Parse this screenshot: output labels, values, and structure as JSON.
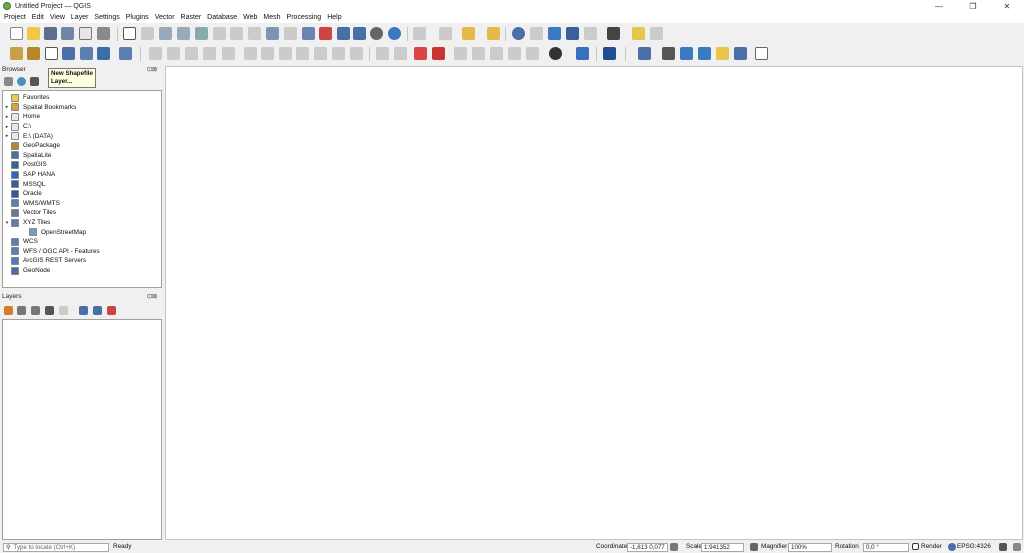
{
  "window": {
    "title": "Untitled Project — QGIS",
    "minimize": "—",
    "restore": "❐",
    "close": "✕"
  },
  "menu": [
    "Project",
    "Edit",
    "View",
    "Layer",
    "Settings",
    "Plugins",
    "Vector",
    "Raster",
    "Database",
    "Web",
    "Mesh",
    "Processing",
    "Help"
  ],
  "browser": {
    "title": "Browser",
    "items": [
      {
        "label": "Favorites",
        "arrow": "",
        "icon": "star-icon",
        "color": "#f2c744"
      },
      {
        "label": "Spatial Bookmarks",
        "arrow": "▸",
        "icon": "bookmark-icon",
        "color": "#d4a53a"
      },
      {
        "label": "Home",
        "arrow": "▸",
        "icon": "folder-icon",
        "color": "#e8e8e8"
      },
      {
        "label": "C:\\",
        "arrow": "▸",
        "icon": "drive-icon",
        "color": "#e8e8e8"
      },
      {
        "label": "E:\\ (DATA)",
        "arrow": "▸",
        "icon": "drive-icon",
        "color": "#e8e8e8"
      },
      {
        "label": "GeoPackage",
        "arrow": "",
        "icon": "geopackage-icon",
        "color": "#b8862b"
      },
      {
        "label": "SpatiaLite",
        "arrow": "",
        "icon": "spatialite-icon",
        "color": "#4a6fa5"
      },
      {
        "label": "PostGIS",
        "arrow": "",
        "icon": "postgis-icon",
        "color": "#336791"
      },
      {
        "label": "SAP HANA",
        "arrow": "",
        "icon": "sap-hana-icon",
        "color": "#2a6ebb"
      },
      {
        "label": "MSSQL",
        "arrow": "",
        "icon": "mssql-icon",
        "color": "#3a5fa0"
      },
      {
        "label": "Oracle",
        "arrow": "",
        "icon": "oracle-icon",
        "color": "#2d5a9a"
      },
      {
        "label": "WMS/WMTS",
        "arrow": "",
        "icon": "wms-icon",
        "color": "#5a7fb0"
      },
      {
        "label": "Vector Tiles",
        "arrow": "",
        "icon": "vector-tiles-icon",
        "color": "#6b7b8c"
      },
      {
        "label": "XYZ Tiles",
        "arrow": "▾",
        "icon": "xyz-tiles-icon",
        "color": "#5a7fb0"
      },
      {
        "label": "OpenStreetMap",
        "arrow": "",
        "icon": "openstreetmap-icon",
        "color": "#7a9ac5",
        "indent": true
      },
      {
        "label": "WCS",
        "arrow": "",
        "icon": "wcs-icon",
        "color": "#5a7fb0"
      },
      {
        "label": "WFS / OGC API - Features",
        "arrow": "",
        "icon": "wfs-icon",
        "color": "#5a7fb0"
      },
      {
        "label": "ArcGIS REST Servers",
        "arrow": "",
        "icon": "arcgis-icon",
        "color": "#4a7fc0"
      },
      {
        "label": "GeoNode",
        "arrow": "",
        "icon": "geonode-icon",
        "color": "#4a6fa5"
      }
    ]
  },
  "layers": {
    "title": "Layers"
  },
  "tooltip": {
    "line1": "New Shapefile",
    "line2": "Layer..."
  },
  "status": {
    "locate_placeholder": "Type to locate (Ctrl+K)",
    "ready": "Ready",
    "coordinate_label": "Coordinate",
    "coordinate_value": "-1,813 0,077",
    "scale_label": "Scale",
    "scale_value": "1:941352",
    "magnifier_label": "Magnifier",
    "magnifier_value": "100%",
    "rotation_label": "Rotation",
    "rotation_value": "0,0 °",
    "render_label": "Render",
    "crs": "EPSG:4326"
  }
}
